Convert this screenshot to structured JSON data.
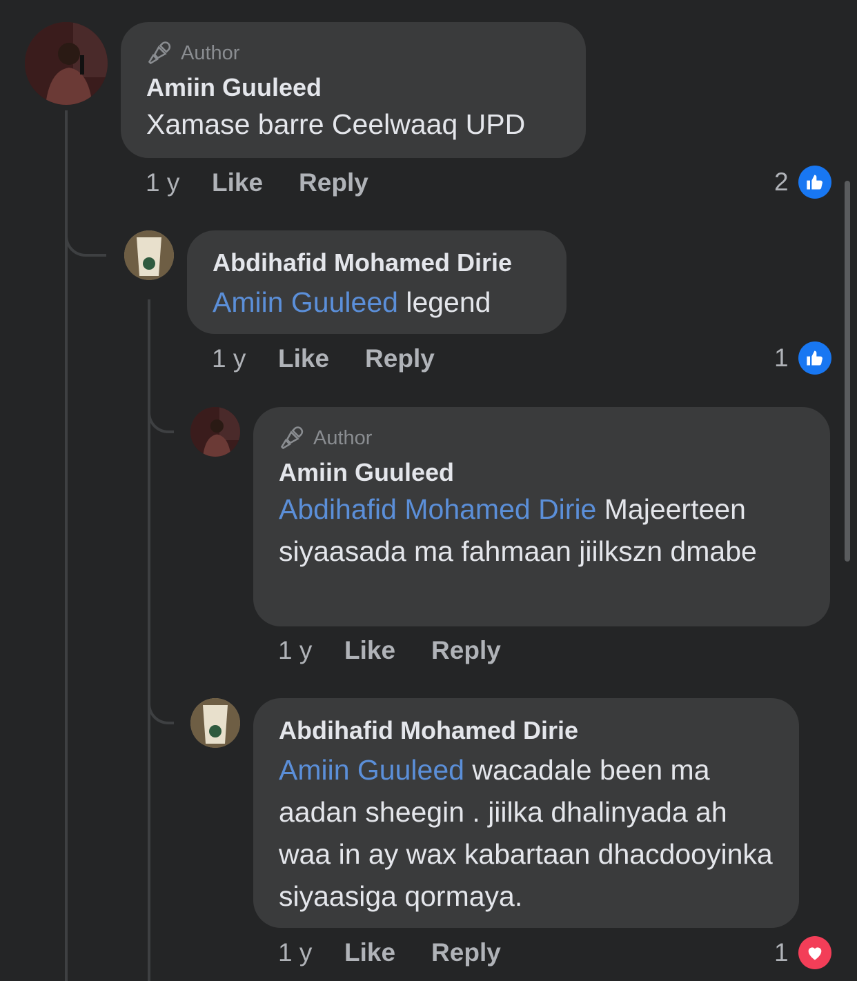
{
  "comments": [
    {
      "author_badge": "Author",
      "name": "Amiin Guuleed",
      "text": "Xamase barre Ceelwaaq UPD",
      "time": "1 y",
      "like": "Like",
      "reply": "Reply",
      "reaction_count": "2",
      "reaction_type": "like-icon"
    },
    {
      "name": "Abdihafid Mohamed Dirie",
      "mention": "Amiin Guuleed",
      "text": " legend",
      "time": "1 y",
      "like": "Like",
      "reply": "Reply",
      "reaction_count": "1",
      "reaction_type": "like-icon"
    },
    {
      "author_badge": "Author",
      "name": "Amiin Guuleed",
      "mention": "Abdihafid Mohamed Dirie",
      "text": " Majeerteen siyaasada ma fahmaan jiilkszn dmabe",
      "time": "1 y",
      "like": "Like",
      "reply": "Reply"
    },
    {
      "name": "Abdihafid Mohamed Dirie",
      "mention": "Amiin Guuleed",
      "text": " wacadale been ma aadan sheegin . jiilka dhalinyada ah waa in ay wax kabartaan dhacdooyinka siyaasiga qormaya.",
      "time": "1 y",
      "like": "Like",
      "reply": "Reply",
      "reaction_count": "1",
      "reaction_type": "love-icon"
    }
  ],
  "colors": {
    "background": "#242526",
    "bubble": "#3a3b3c",
    "mention": "#5b8fd9",
    "like": "#1877f2",
    "love": "#f33e58"
  }
}
